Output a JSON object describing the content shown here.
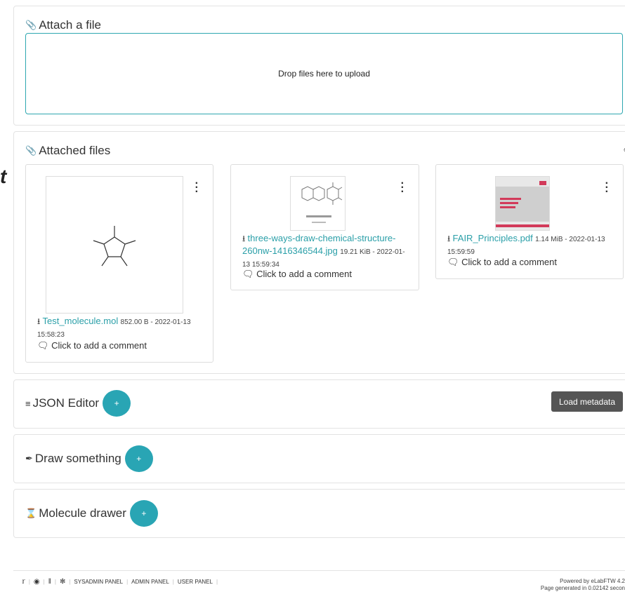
{
  "attach": {
    "title": "Attach a file",
    "drop_text": "Drop files here to upload"
  },
  "attached": {
    "title": "Attached files",
    "files": [
      {
        "name": "Test_molecule.mol",
        "size_date": "852.00 B - 2022-01-13",
        "time": "15:58:23",
        "comment": "Click to add a comment"
      },
      {
        "name_line1": "three-ways-draw-chemical-structure-",
        "name_line2": "260nw-1416346544.jpg",
        "size_date": "19.21 KiB - 2022-01-",
        "time": "13 15:59:34",
        "comment": "Click to add a comment"
      },
      {
        "name": "FAIR_Principles.pdf",
        "size_date": "1.14 MiB - 2022-01-13",
        "time": "15:59:59",
        "comment": "Click to add a comment"
      }
    ]
  },
  "json_editor": {
    "title": "JSON Editor",
    "plus": "+",
    "load_label": "Load metadata"
  },
  "draw": {
    "title": "Draw something",
    "plus": "+"
  },
  "molecule": {
    "title": "Molecule drawer",
    "plus": "+"
  },
  "stray_char": "t",
  "footer": {
    "links": [
      "SYSADMIN PANEL",
      "ADMIN PANEL",
      "USER PANEL"
    ],
    "powered": "Powered by eLabFTW 4.2",
    "generated": "Page generated in 0.02142 secon"
  },
  "colors": {
    "accent": "#29a5b4",
    "link": "#2a9fa8",
    "button_dark": "#555555"
  }
}
